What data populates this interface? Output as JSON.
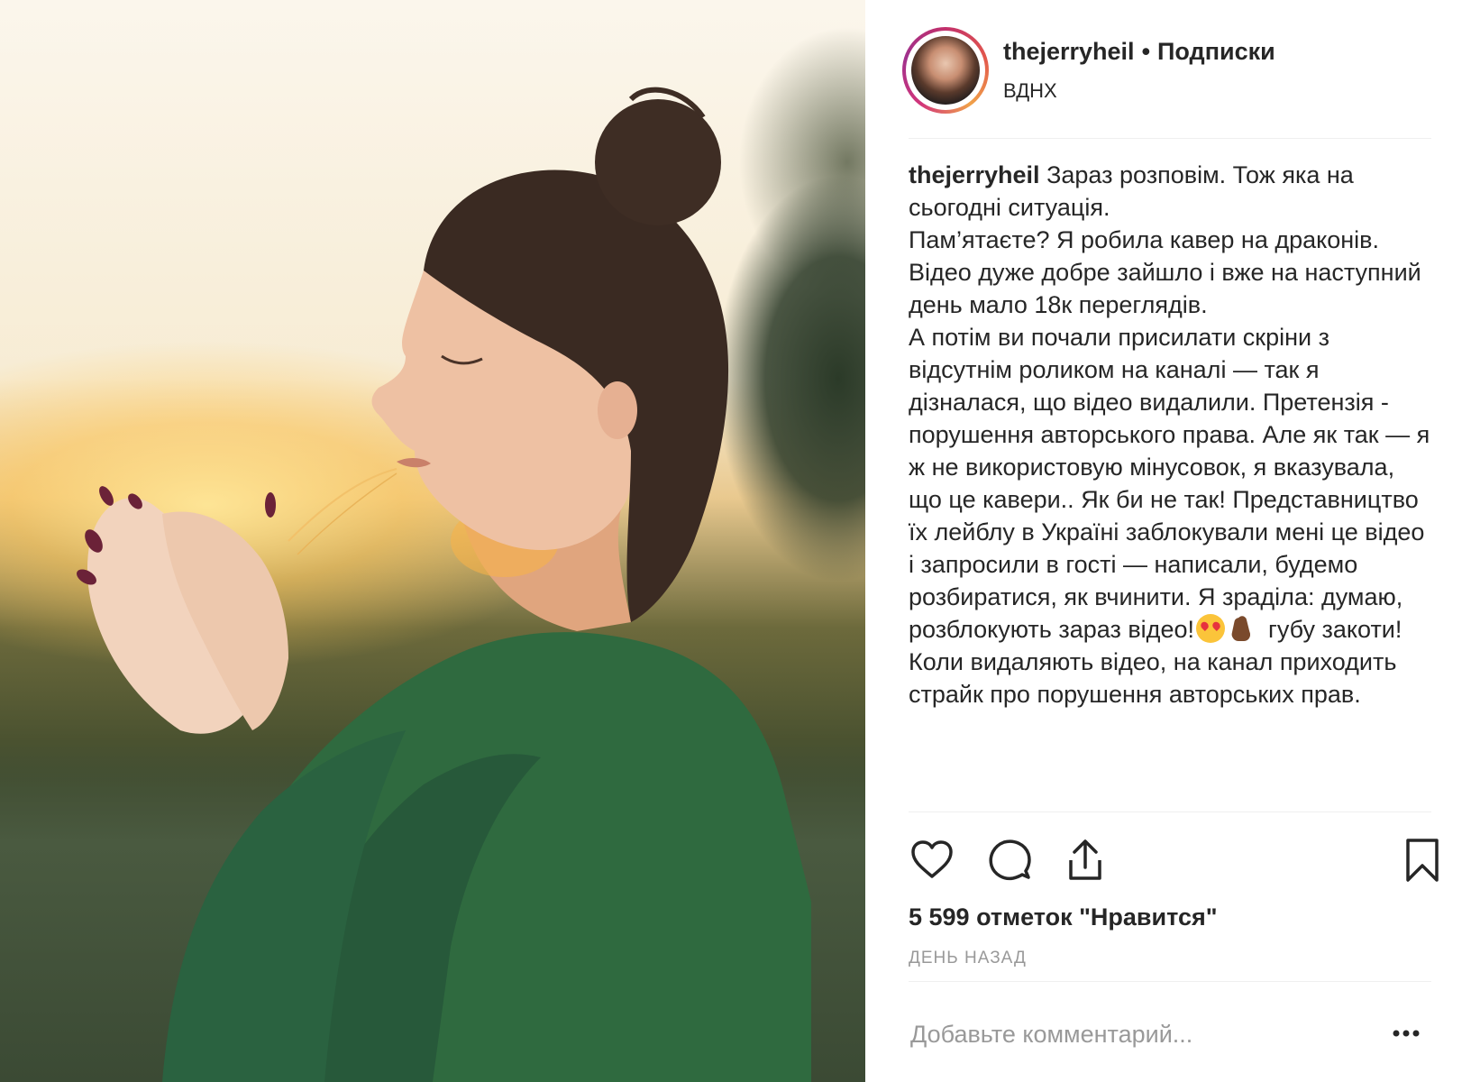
{
  "post": {
    "author": "thejerryheil",
    "separator": "•",
    "follow_label": "Подписки",
    "location": "ВДНХ"
  },
  "caption": {
    "username": "thejerryheil",
    "line1": "Зараз розповім. Тож яка на сьогодні ситуація.",
    "line2": "Пам’ятаєте? Я робила кавер на драконів. Відео дуже добре зайшло і вже на наступний день мало 18к переглядів.",
    "line3": "А потім ви почали присилати скріни з відсутнім роликом на каналі — так я дізналася, що відео видалили. Претензія - порушення авторського права. Але як так — я ж не використовую мінусовок, я вказувала, що це кавери.. Як би не так! Представництво їх лейблу в Україні заблокували мені це відео і запросили в гості — написали, будемо розбиратися, як вчинити. Я зраділа: думаю, розблокують зараз відео!",
    "line3_end": "губу закоти!",
    "line4": "Коли видаляють відео, на канал приходить страйк про порушення авторських прав."
  },
  "actions": {
    "like_icon": "heart-outline",
    "comment_icon": "speech-bubble",
    "share_icon": "upload-arrow",
    "save_icon": "bookmark-outline"
  },
  "stats": {
    "likes": "5 599 отметок \"Нравится\"",
    "time": "ДЕНЬ НАЗАД"
  },
  "comment": {
    "placeholder": "Добавьте комментарий..."
  },
  "colors": {
    "text": "#262626",
    "muted": "#999999",
    "divider": "#efefef",
    "avatar_ring": "#c2306b"
  }
}
